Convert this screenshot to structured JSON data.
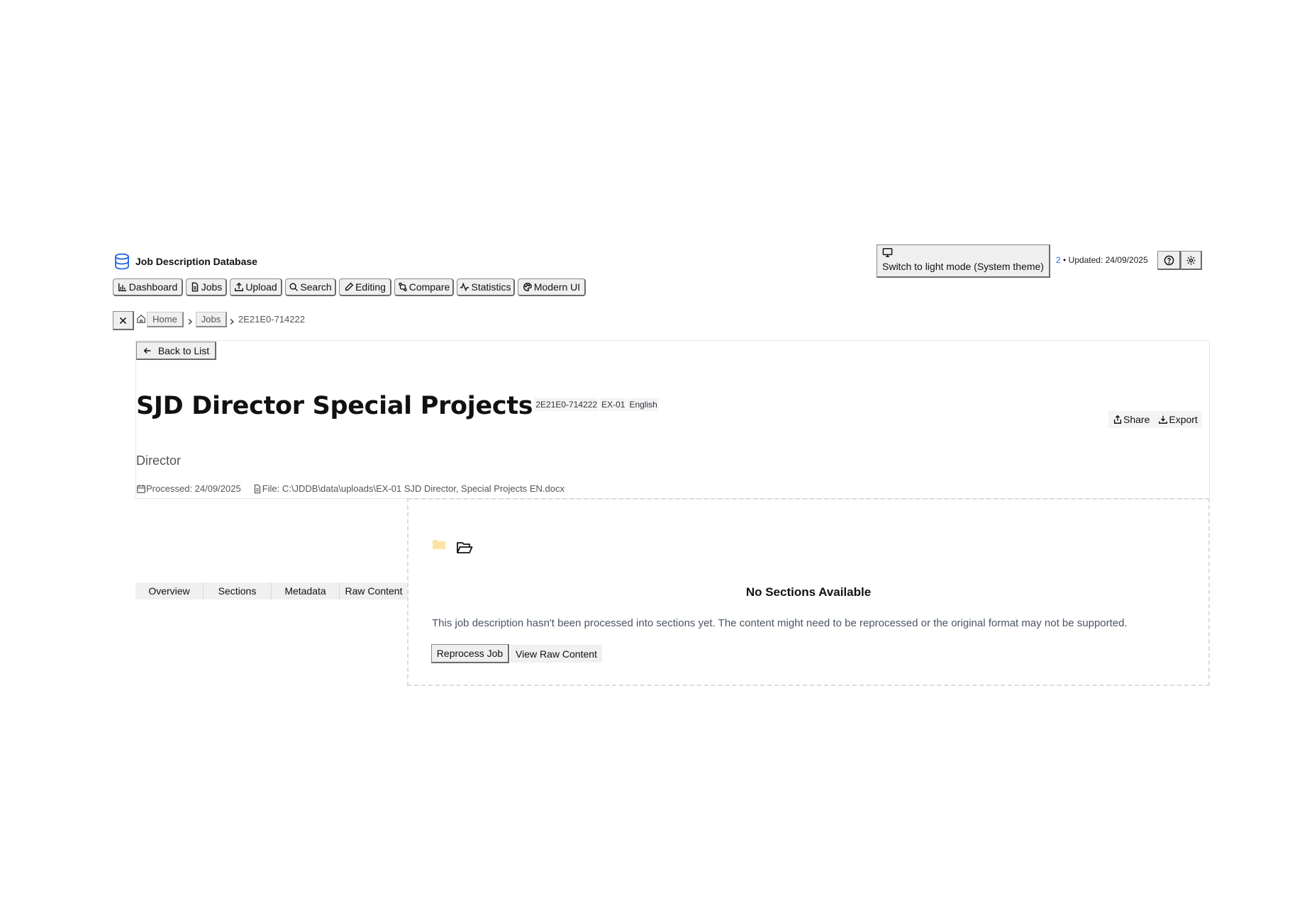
{
  "app": {
    "title": "Job Description Database",
    "icon": "database-icon",
    "accent_color": "#2563eb"
  },
  "nav": {
    "items": [
      {
        "label": "Dashboard",
        "icon": "bar-chart-icon"
      },
      {
        "label": "Jobs",
        "icon": "file-text-icon"
      },
      {
        "label": "Upload",
        "icon": "upload-icon"
      },
      {
        "label": "Search",
        "icon": "search-icon"
      },
      {
        "label": "Editing",
        "icon": "pencil-icon"
      },
      {
        "label": "Compare",
        "icon": "compare-icon"
      },
      {
        "label": "Statistics",
        "icon": "activity-icon"
      },
      {
        "label": "Modern UI",
        "icon": "palette-icon"
      }
    ]
  },
  "header_right": {
    "theme_button_label": "Switch to light mode (System theme)",
    "theme_icon": "monitor-icon",
    "count": "2",
    "updated_text": " • Updated: 24/09/2025",
    "help_icon": "help-circle-icon",
    "settings_icon": "gear-icon"
  },
  "breadcrumb": {
    "close_icon": "close-icon",
    "home_icon": "home-icon",
    "home": "Home",
    "jobs": "Jobs",
    "current": "2E21E0-714222"
  },
  "job": {
    "back_label": "Back to List",
    "title": "SJD Director Special Projects",
    "badges": [
      "2E21E0-714222",
      "EX-01",
      "English"
    ],
    "subtitle": "Director",
    "processed": "Processed: 24/09/2025",
    "file": "File: C:\\JDDB\\data\\uploads\\EX-01 SJD Director, Special Projects EN.docx",
    "share_label": "Share",
    "export_label": "Export"
  },
  "tabs": [
    "Overview",
    "Sections",
    "Metadata",
    "Raw Content"
  ],
  "empty_state": {
    "heading": "No Sections Available",
    "message": "This job description hasn't been processed into sections yet. The content might need to be reprocessed or the original format may not be supported.",
    "reprocess_label": "Reprocess Job",
    "view_raw_label": "View Raw Content"
  }
}
